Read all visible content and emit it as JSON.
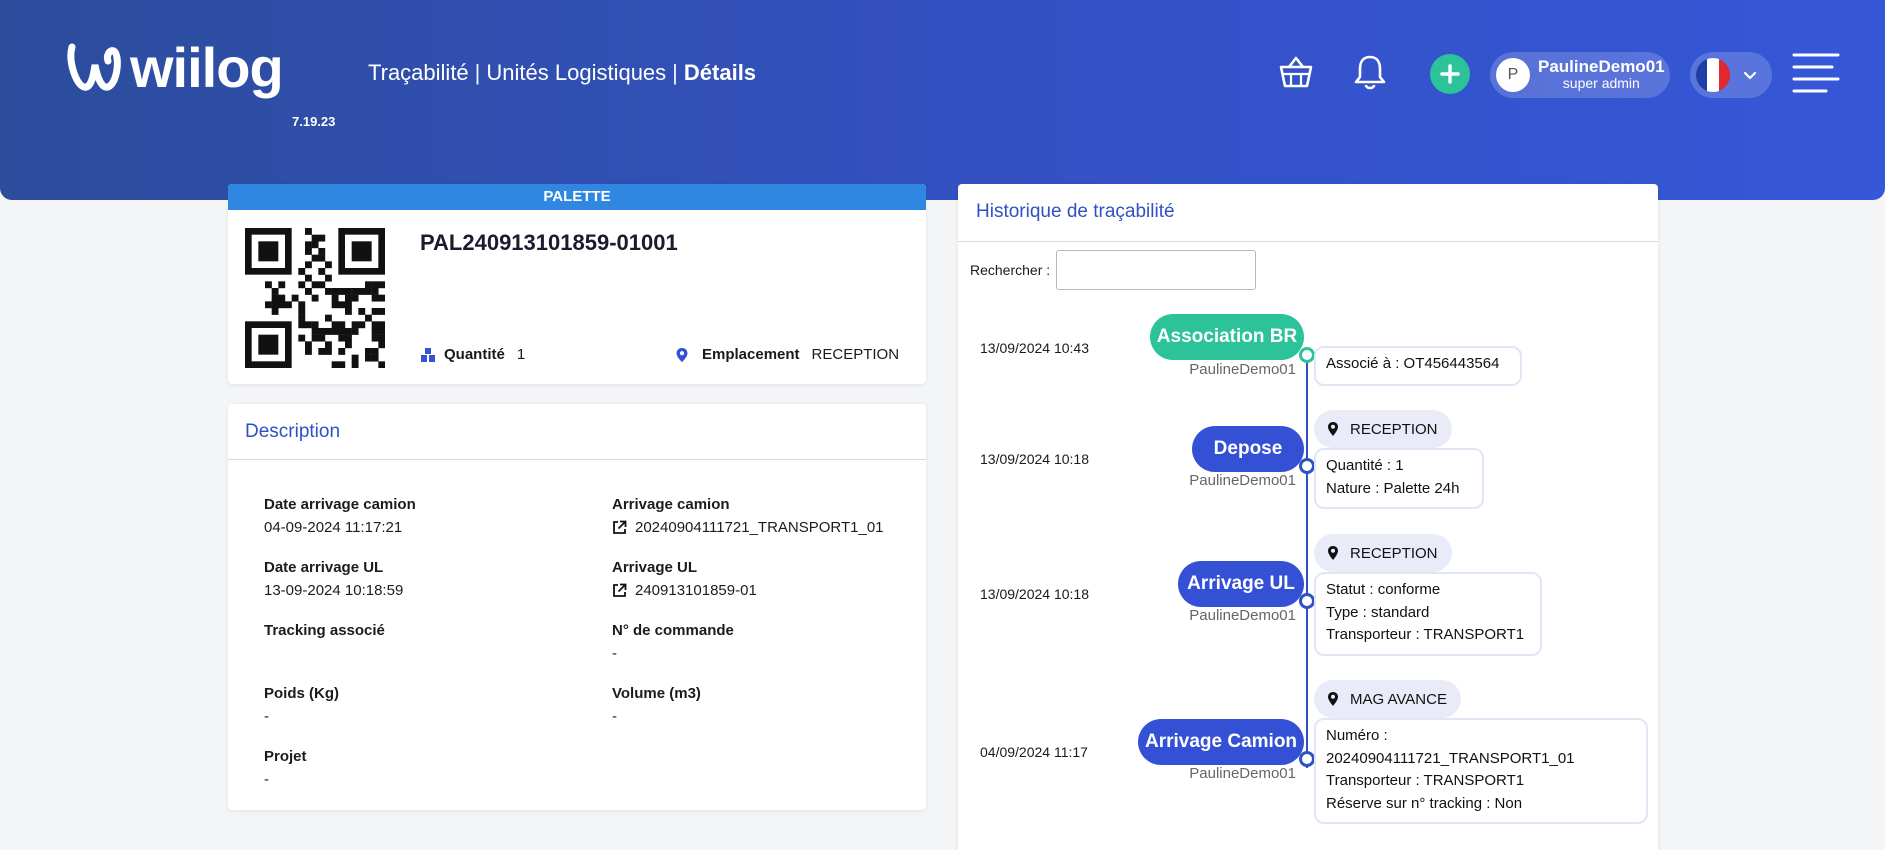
{
  "header": {
    "logo_text": "wiilog",
    "version": "7.19.23",
    "breadcrumb": [
      "Traçabilité",
      "Unités Logistiques",
      "Détails"
    ],
    "breadcrumb_sep": "|",
    "icons": [
      "basket-icon",
      "bell-icon",
      "plus-icon",
      "chevron-down-icon",
      "hamburger-menu-icon"
    ],
    "user": {
      "initial": "P",
      "name": "PaulineDemo01",
      "role": "super admin"
    },
    "language_flag": "fr",
    "colors": {
      "header_start": "#2c4d9c",
      "header_end": "#3557d8",
      "add_button": "#2cc39b"
    }
  },
  "palette": {
    "header": "PALETTE",
    "code": "PAL240913101859-01001",
    "quantity_label": "Quantité",
    "quantity_value": "1",
    "location_label": "Emplacement",
    "location_value": "RECEPTION"
  },
  "description": {
    "title": "Description",
    "items": [
      {
        "label": "Date arrivage camion",
        "value": "04-09-2024 11:17:21"
      },
      {
        "label": "Arrivage camion",
        "value": "20240904111721_TRANSPORT1_01",
        "link": true
      },
      {
        "label": "Date arrivage UL",
        "value": "13-09-2024 10:18:59"
      },
      {
        "label": "Arrivage UL",
        "value": "240913101859-01",
        "link": true
      },
      {
        "label": "Tracking associé",
        "value": ""
      },
      {
        "label": "N° de commande",
        "value": "-"
      },
      {
        "label": "Poids (Kg)",
        "value": "-"
      },
      {
        "label": "Volume (m3)",
        "value": "-"
      },
      {
        "label": "Projet",
        "value": "-"
      }
    ]
  },
  "history": {
    "title": "Historique de traçabilité",
    "search_label": "Rechercher :",
    "search_value": "",
    "events": [
      {
        "date": "13/09/2024 10:43",
        "label": "Association BR",
        "color": "#2cc39b",
        "user": "PaulineDemo01",
        "location": "",
        "details": [
          "Associé à : OT456443564"
        ]
      },
      {
        "date": "13/09/2024 10:18",
        "label": "Depose",
        "color": "#3451d6",
        "user": "PaulineDemo01",
        "location": "RECEPTION",
        "details": [
          "Quantité : 1",
          "Nature : Palette 24h"
        ]
      },
      {
        "date": "13/09/2024 10:18",
        "label": "Arrivage UL",
        "color": "#3451d6",
        "user": "PaulineDemo01",
        "location": "RECEPTION",
        "details": [
          "Statut : conforme",
          "Type : standard",
          "Transporteur : TRANSPORT1"
        ]
      },
      {
        "date": "04/09/2024 11:17",
        "label": "Arrivage Camion",
        "color": "#3451d6",
        "user": "PaulineDemo01",
        "location": "MAG AVANCE",
        "details": [
          "Numéro :",
          "20240904111721_TRANSPORT1_01",
          "Transporteur : TRANSPORT1",
          "Réserve sur n° tracking : Non"
        ]
      }
    ]
  }
}
